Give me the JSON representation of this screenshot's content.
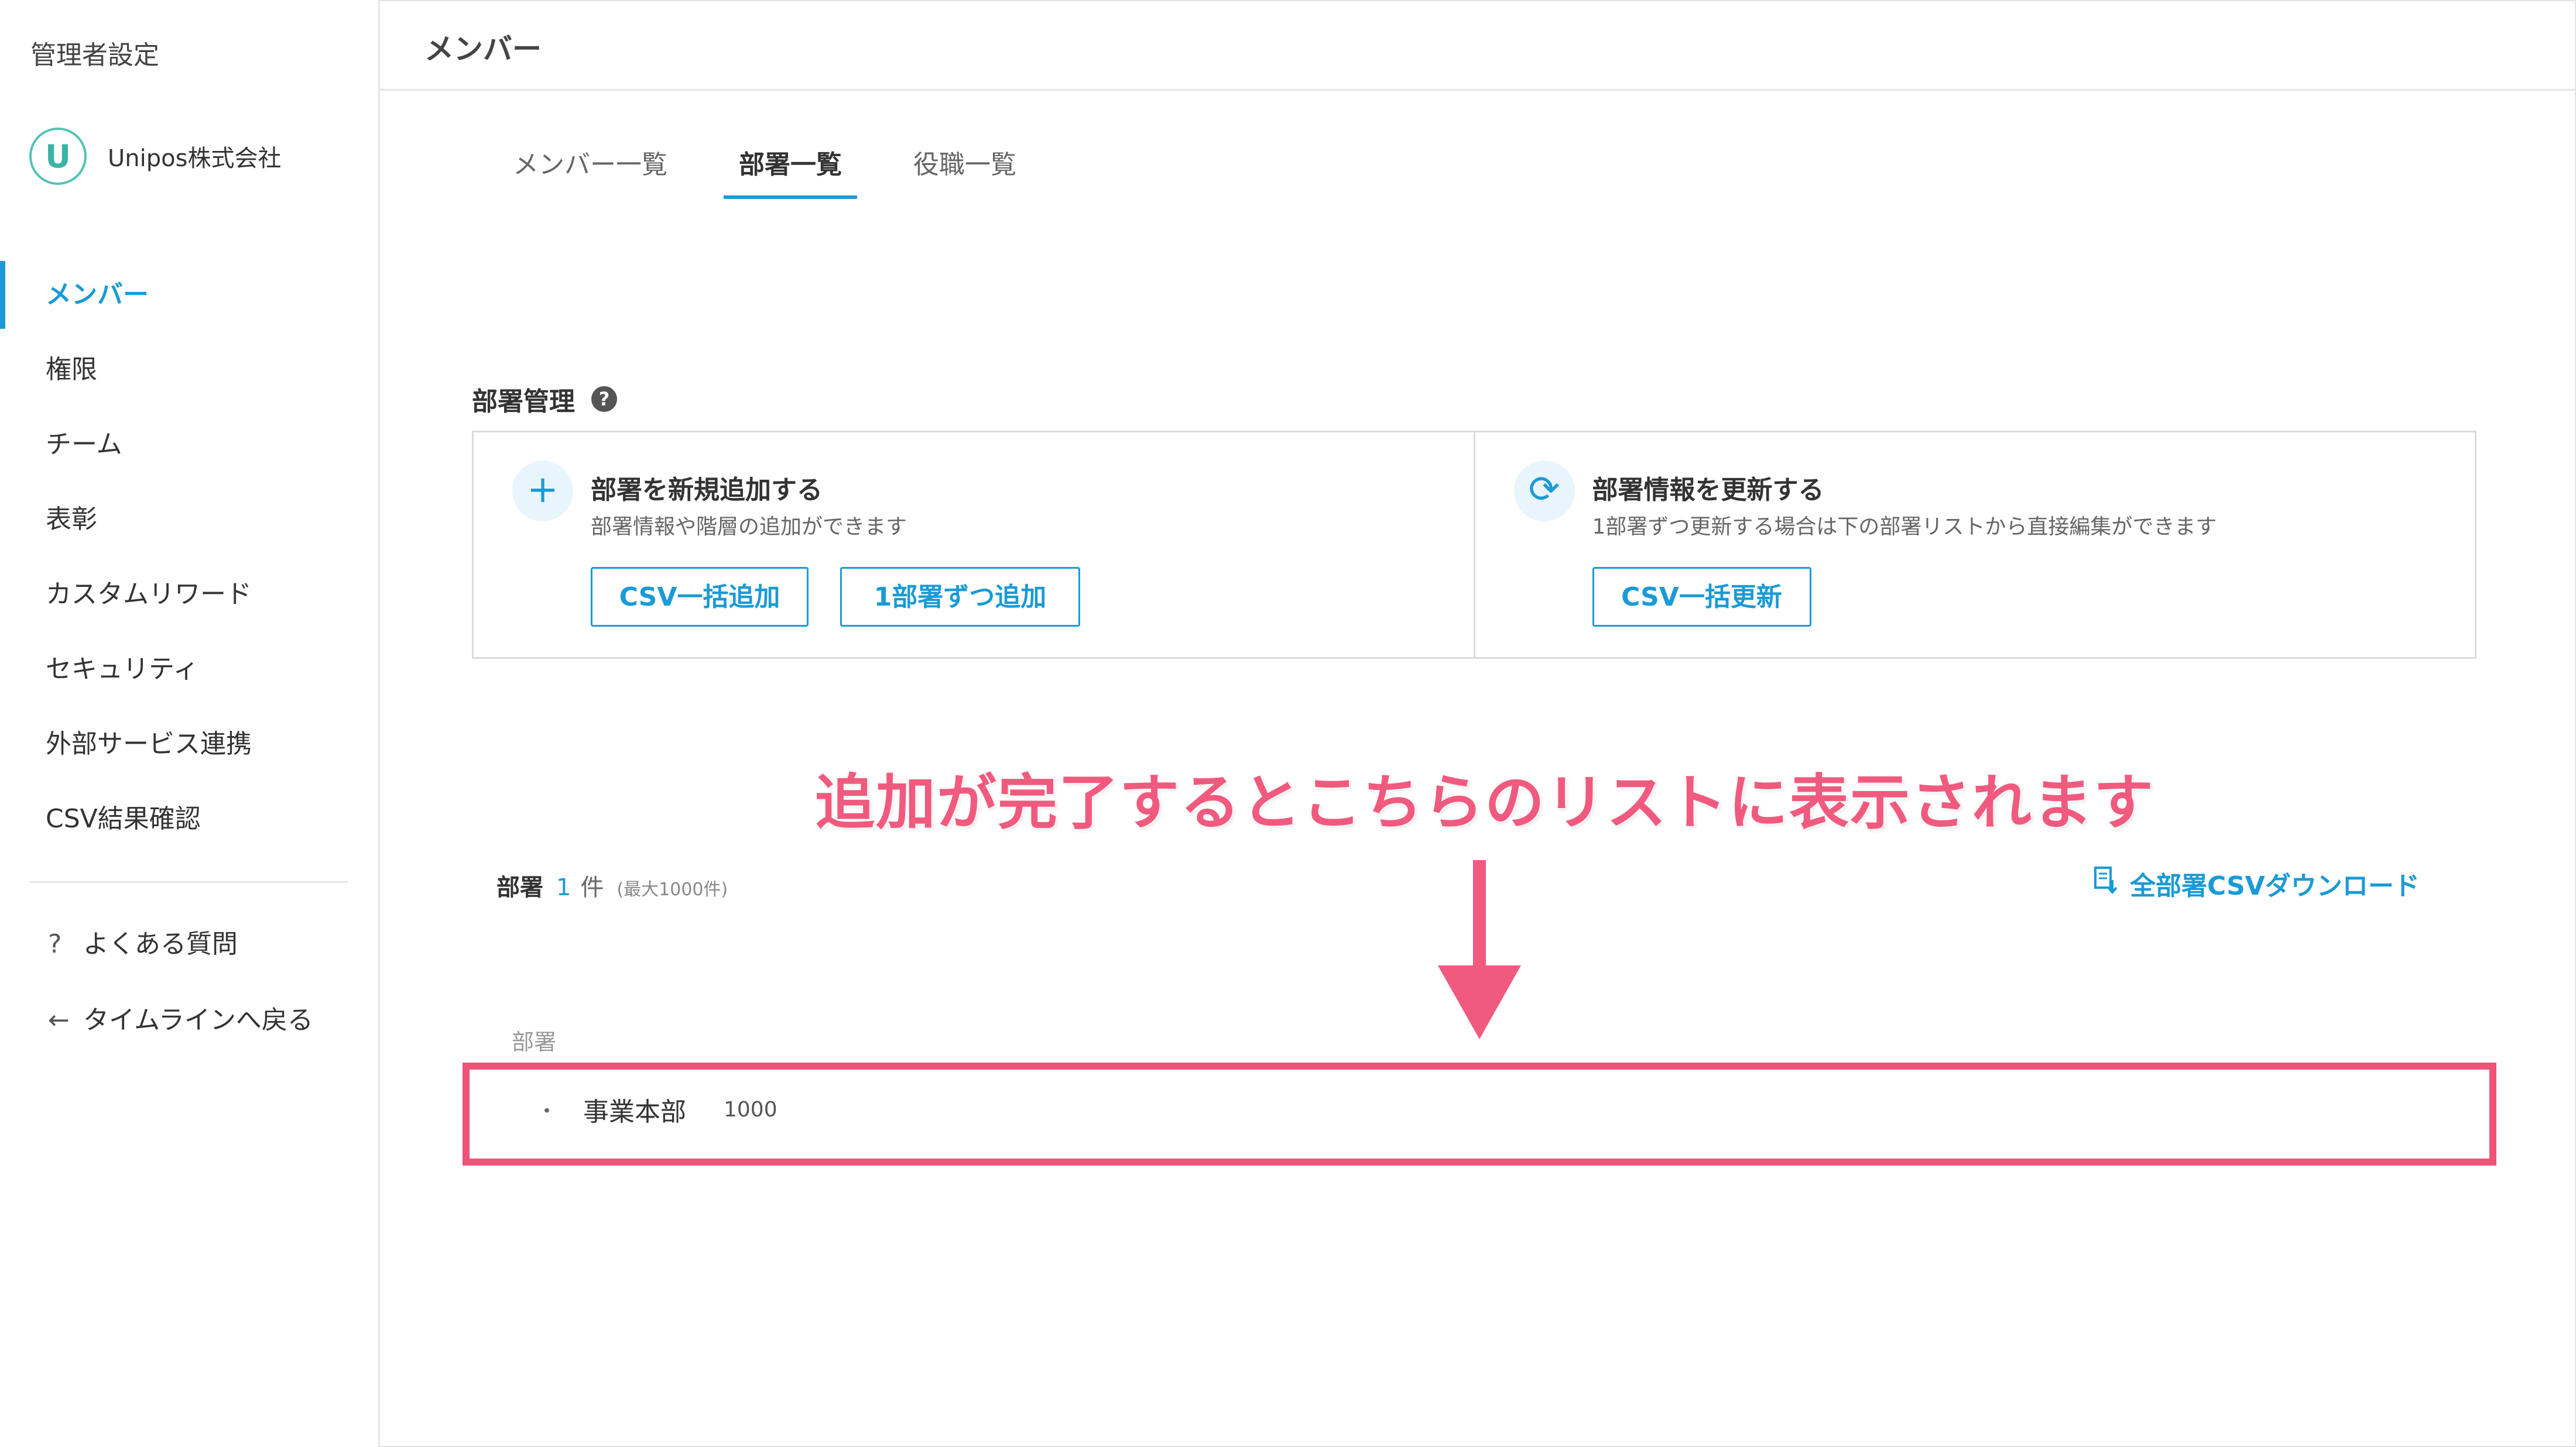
{
  "sidebar": {
    "title": "管理者設定",
    "company_logo_letter": "U",
    "company_name": "Unipos株式会社",
    "nav_items": [
      {
        "label": "メンバー",
        "active": true
      },
      {
        "label": "権限"
      },
      {
        "label": "チーム"
      },
      {
        "label": "表彰"
      },
      {
        "label": "カスタムリワード"
      },
      {
        "label": "セキュリティ"
      },
      {
        "label": "外部サービス連携"
      },
      {
        "label": "CSV結果確認"
      }
    ],
    "faq_icon": "?",
    "faq_label": "よくある質問",
    "back_icon": "←",
    "back_label": "タイムラインへ戻る"
  },
  "header": {
    "title": "メンバー"
  },
  "tabs": [
    {
      "label": "メンバー一覧"
    },
    {
      "label": "部署一覧",
      "active": true
    },
    {
      "label": "役職一覧"
    }
  ],
  "section": {
    "title": "部署管理",
    "help_icon": "?",
    "cards": [
      {
        "icon": "+",
        "title": "部署を新規追加する",
        "desc": "部署情報や階層の追加ができます",
        "buttons": [
          "CSV一括追加",
          "1部署ずつ追加"
        ]
      },
      {
        "icon": "⟳",
        "title": "部署情報を更新する",
        "desc": "1部署ずつ更新する場合は下の部署リストから直接編集ができます",
        "buttons": [
          "CSV一括更新"
        ]
      }
    ]
  },
  "annotation": {
    "text": "追加が完了するとこちらのリストに表示されます"
  },
  "list": {
    "label": "部署",
    "count": "1",
    "unit": "件",
    "max": "(最大1000件)",
    "download_label": "全部署CSVダウンロード",
    "column_header": "部署",
    "rows": [
      {
        "bullet": "・",
        "name": "事業本部",
        "count": "1000"
      }
    ]
  },
  "colors": {
    "accent": "#1a9ad6",
    "annotation": "#f05a7e",
    "border": "#dcdcdc"
  }
}
